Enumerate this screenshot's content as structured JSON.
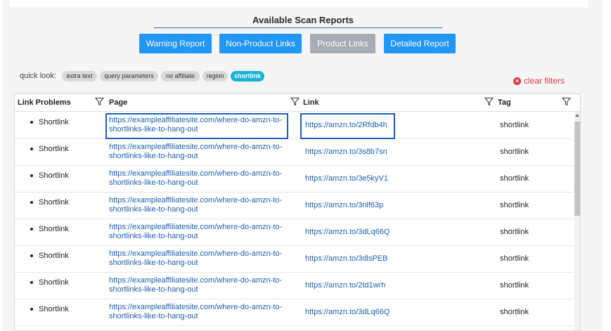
{
  "header": {
    "title": "Available Scan Reports"
  },
  "buttons": [
    {
      "label": "Warning Report",
      "state": "enabled"
    },
    {
      "label": "Non-Product Links",
      "state": "enabled"
    },
    {
      "label": "Product Links",
      "state": "disabled"
    },
    {
      "label": "Detailed Report",
      "state": "enabled"
    }
  ],
  "quick_look": {
    "label": "quick look:",
    "chips": [
      {
        "label": "extra text",
        "active": false
      },
      {
        "label": "query parameters",
        "active": false
      },
      {
        "label": "no affiliate",
        "active": false
      },
      {
        "label": "region",
        "active": false
      },
      {
        "label": "shortlink",
        "active": true
      }
    ]
  },
  "clear_filters": {
    "label": "clear filters",
    "icon": "close-circle-icon"
  },
  "table": {
    "columns": [
      "Link Problems",
      "Page",
      "Link",
      "Tag"
    ],
    "rows": [
      {
        "problem": "Shortlink",
        "page_line1": "https://exampleaffiliatesite.com/where-do-amzn-to-",
        "page_line2": "shortlinks-like-to-hang-out",
        "link": "https://amzn.to/2Rfdb4h",
        "tag": "shortlink"
      },
      {
        "problem": "Shortlink",
        "page_line1": "https://exampleaffiliatesite.com/where-do-amzn-to-",
        "page_line2": "shortlinks-like-to-hang-out",
        "link": "https://amzn.to/3s8b7sn",
        "tag": "shortlink"
      },
      {
        "problem": "Shortlink",
        "page_line1": "https://exampleaffiliatesite.com/where-do-amzn-to-",
        "page_line2": "shortlinks-like-to-hang-out",
        "link": "https://amzn.to/3e5kyV1",
        "tag": "shortlink"
      },
      {
        "problem": "Shortlink",
        "page_line1": "https://exampleaffiliatesite.com/where-do-amzn-to-",
        "page_line2": "shortlinks-like-to-hang-out",
        "link": "https://amzn.to/3nlf63p",
        "tag": "shortlink"
      },
      {
        "problem": "Shortlink",
        "page_line1": "https://exampleaffiliatesite.com/where-do-amzn-to-",
        "page_line2": "shortlinks-like-to-hang-out",
        "link": "https://amzn.to/3dLq66Q",
        "tag": "shortlink"
      },
      {
        "problem": "Shortlink",
        "page_line1": "https://exampleaffiliatesite.com/where-do-amzn-to-",
        "page_line2": "shortlinks-like-to-hang-out",
        "link": "https://amzn.to/3dlsPEB",
        "tag": "shortlink"
      },
      {
        "problem": "Shortlink",
        "page_line1": "https://exampleaffiliatesite.com/where-do-amzn-to-",
        "page_line2": "shortlinks-like-to-hang-out",
        "link": "https://amzn.to/2td1wrh",
        "tag": "shortlink"
      },
      {
        "problem": "Shortlink",
        "page_line1": "https://exampleaffiliatesite.com/where-do-amzn-to-",
        "page_line2": "shortlinks-like-to-hang-out",
        "link": "https://amzn.to/3dLq66Q",
        "tag": "shortlink"
      }
    ]
  },
  "colors": {
    "primary_button": "#2196f3",
    "disabled_button": "#a8adb3",
    "active_chip": "#1ab3d6",
    "link_text": "#1d5fb0",
    "clear_filters": "#e0384a",
    "highlight_border": "#1f5fb5"
  }
}
